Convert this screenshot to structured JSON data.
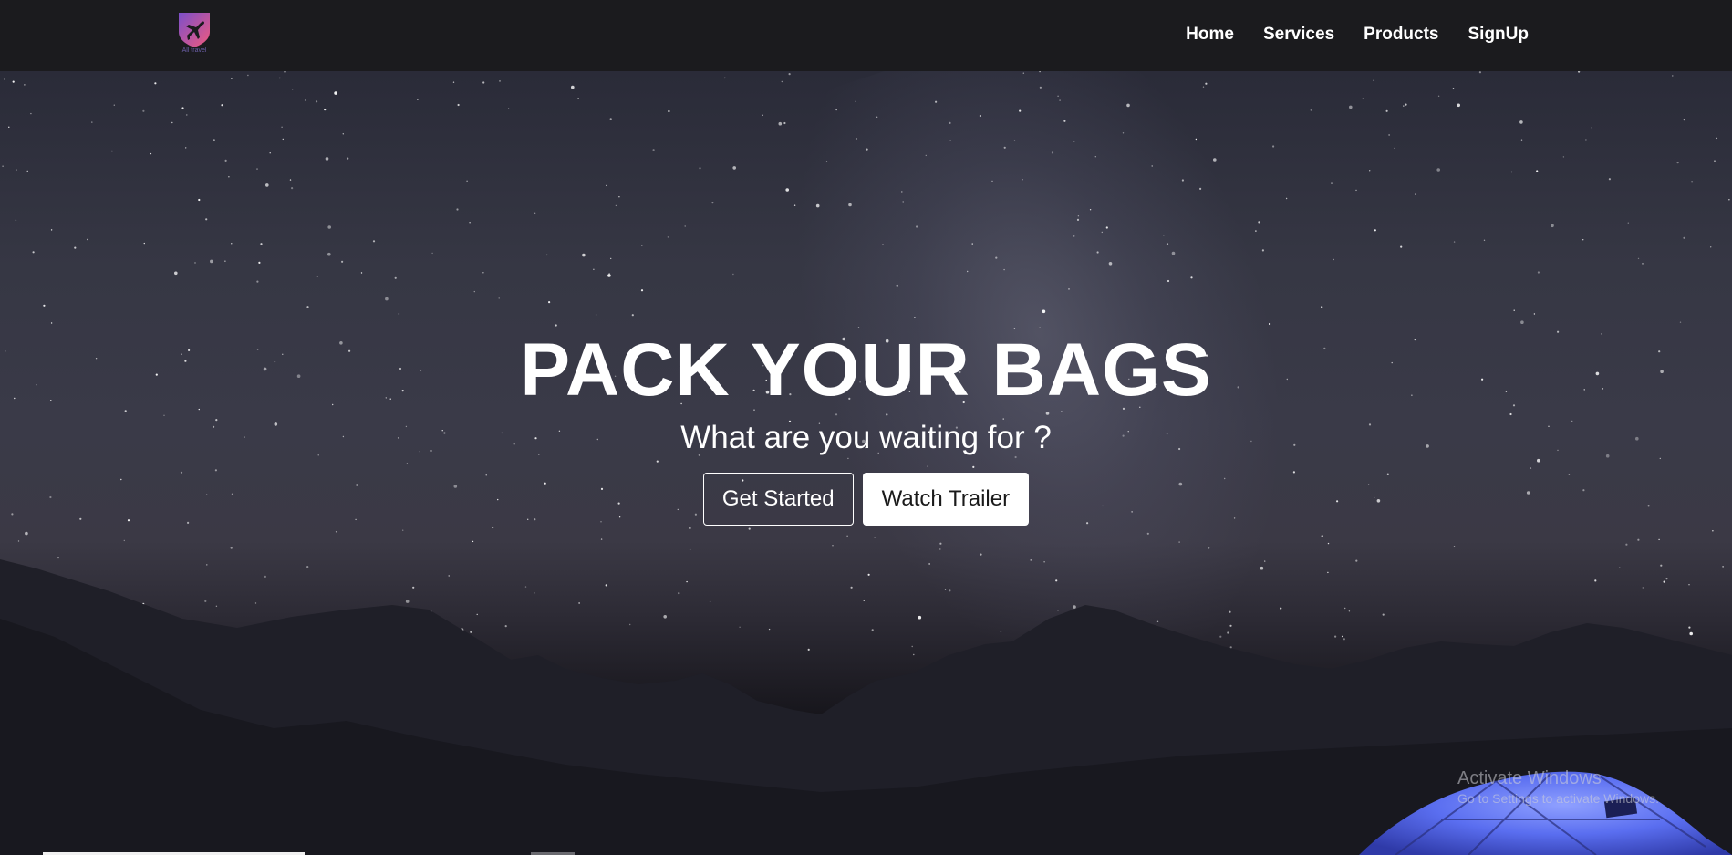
{
  "navbar": {
    "logo_text": "All travel",
    "links": [
      "Home",
      "Services",
      "Products",
      "SignUp"
    ]
  },
  "hero": {
    "title": "PACK YOUR BAGS",
    "subtitle": "What are you waiting for ?",
    "buttons": {
      "get_started": "Get Started",
      "watch_trailer": "Watch Trailer"
    }
  },
  "watermark": {
    "title": "Activate Windows",
    "subtitle": "Go to Settings to activate Windows."
  },
  "colors": {
    "navbar_bg": "#1b1b1e",
    "logo_gradient_start": "#7b4fc9",
    "logo_gradient_end": "#f05a7e",
    "tent_blue": "#5a6ef0"
  }
}
